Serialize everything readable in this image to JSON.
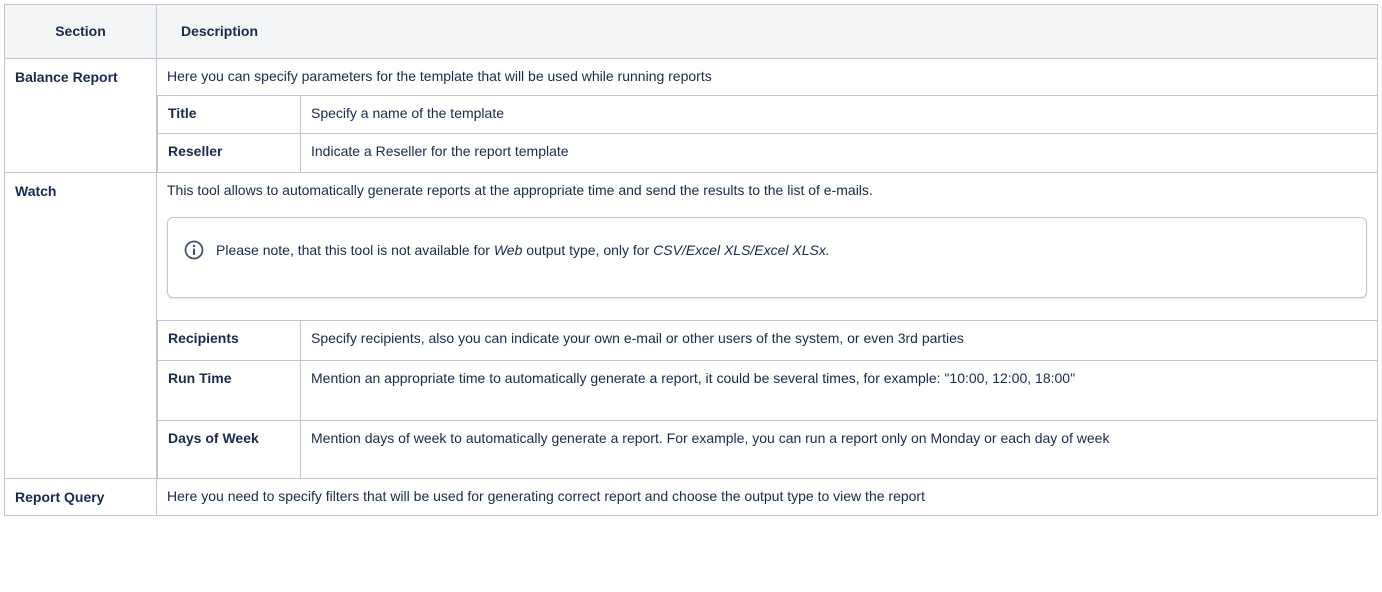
{
  "headers": {
    "section": "Section",
    "description": "Description"
  },
  "rows": {
    "balance": {
      "section": "Balance Report",
      "text": "Here you can specify parameters for the template that will be used while running reports",
      "sub": [
        {
          "label": "Title",
          "text": "Specify a name of the template"
        },
        {
          "label": "Reseller",
          "text": "Indicate a Reseller for the report template"
        }
      ]
    },
    "watch": {
      "section": "Watch",
      "text": "This tool allows to automatically generate reports at the appropriate time and send the results to the list of e-mails.",
      "note": {
        "icon": "info-icon",
        "part1": "Please note, that this tool is not available for ",
        "em1": "Web",
        "part2": " output type, only for ",
        "em2": "CSV/Excel XLS/Excel XLSx."
      },
      "sub": [
        {
          "label": "Recipients",
          "text": "Specify recipients, also you can indicate your own e-mail or other users of the system, or even 3rd parties"
        },
        {
          "label": "Run Time",
          "text": "Mention an appropriate time to automatically generate a report, it could be several times, for example: \"10:00, 12:00, 18:00\""
        },
        {
          "label": "Days of Week",
          "text": "Mention days of week to automatically generate a report. For example, you can run a report only on Monday or each day of week"
        }
      ]
    },
    "query": {
      "section": "Report Query",
      "text": "Here you need to specify filters that will be used for generating correct report and choose the output type to view the report"
    }
  }
}
